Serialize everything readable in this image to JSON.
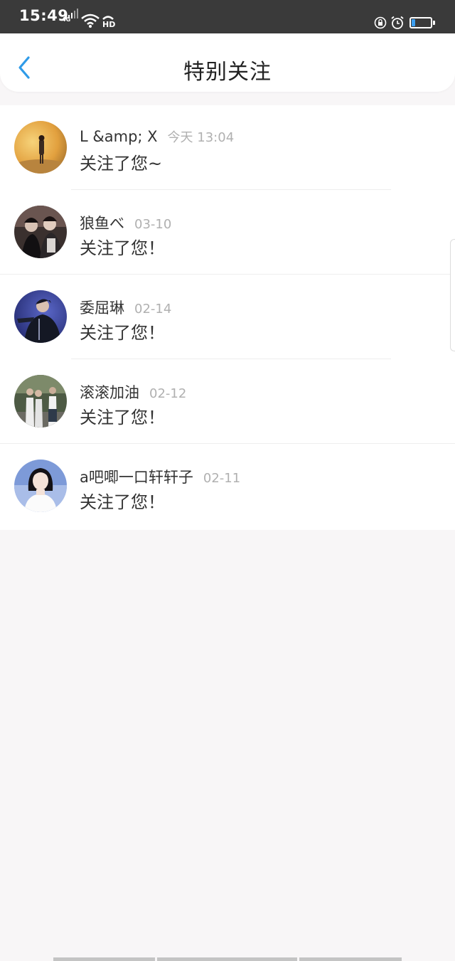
{
  "status_bar": {
    "time": "15:49",
    "network": "4G",
    "hd": "HD",
    "battery_level": 0.2
  },
  "header": {
    "title": "特别关注"
  },
  "notifications": [
    {
      "name": "L &amp; X",
      "time": "今天 13:04",
      "message": "关注了您~"
    },
    {
      "name": "狼鱼べ",
      "time": "03-10",
      "message": "关注了您！"
    },
    {
      "name": "委屈琳",
      "time": "02-14",
      "message": "关注了您！"
    },
    {
      "name": "滚滚加油",
      "time": "02-12",
      "message": "关注了您！"
    },
    {
      "name": "a吧唧一口轩轩子",
      "time": "02-11",
      "message": "关注了您！"
    }
  ],
  "colors": {
    "accent": "#2f9be8",
    "status_bar": "#3a3a3a",
    "background": "#f8f6f7"
  }
}
